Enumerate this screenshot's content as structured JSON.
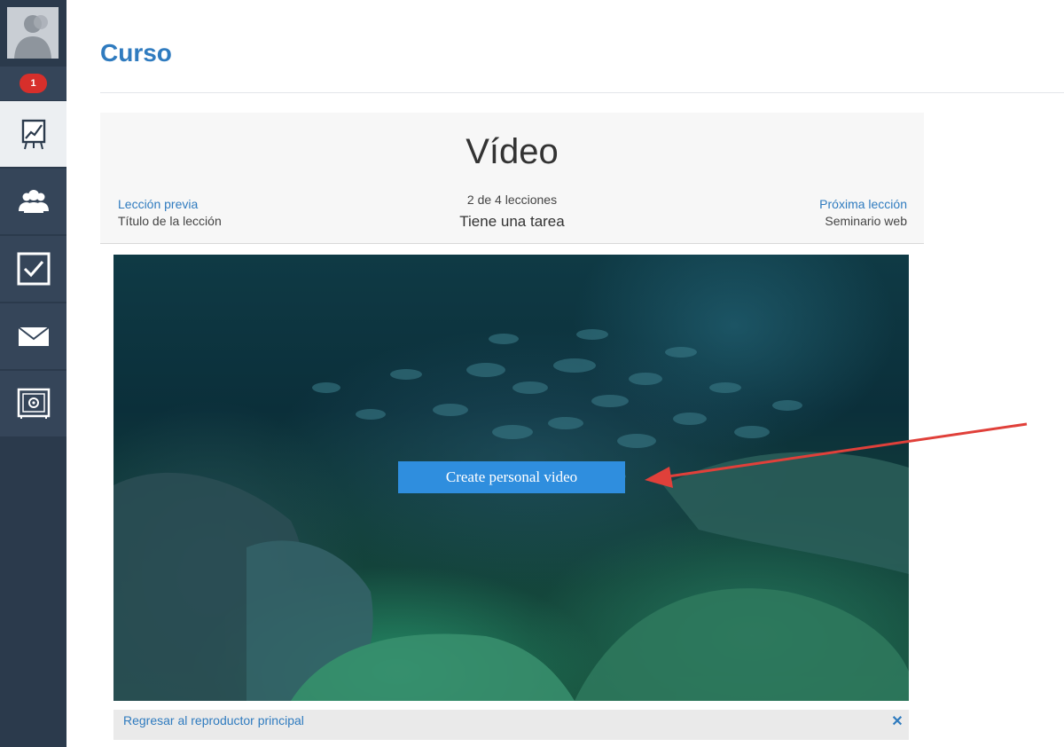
{
  "header": {
    "title": "Curso"
  },
  "sidebar": {
    "badge_count": "1",
    "items": [
      {
        "icon": "presentation-chart-icon",
        "active": true
      },
      {
        "icon": "users-icon",
        "active": false
      },
      {
        "icon": "checkbox-icon",
        "active": false
      },
      {
        "icon": "mail-icon",
        "active": false
      },
      {
        "icon": "safe-icon",
        "active": false
      }
    ]
  },
  "lesson": {
    "title": "Vídeo",
    "prev_label": "Lección previa",
    "prev_name": "Título de la lección",
    "progress": "2 de 4 lecciones",
    "task": "Tiene una tarea",
    "next_label": "Próxima lección",
    "next_name": "Seminario web"
  },
  "video": {
    "create_button": "Create personal video"
  },
  "footer": {
    "back_link": "Regresar al reproductor principal",
    "close_icon": "close-icon"
  },
  "colors": {
    "accent": "#2f7bbf",
    "sidebar": "#354559",
    "badge": "#d72f2b",
    "button": "#2f8ede",
    "arrow": "#e0403a"
  }
}
